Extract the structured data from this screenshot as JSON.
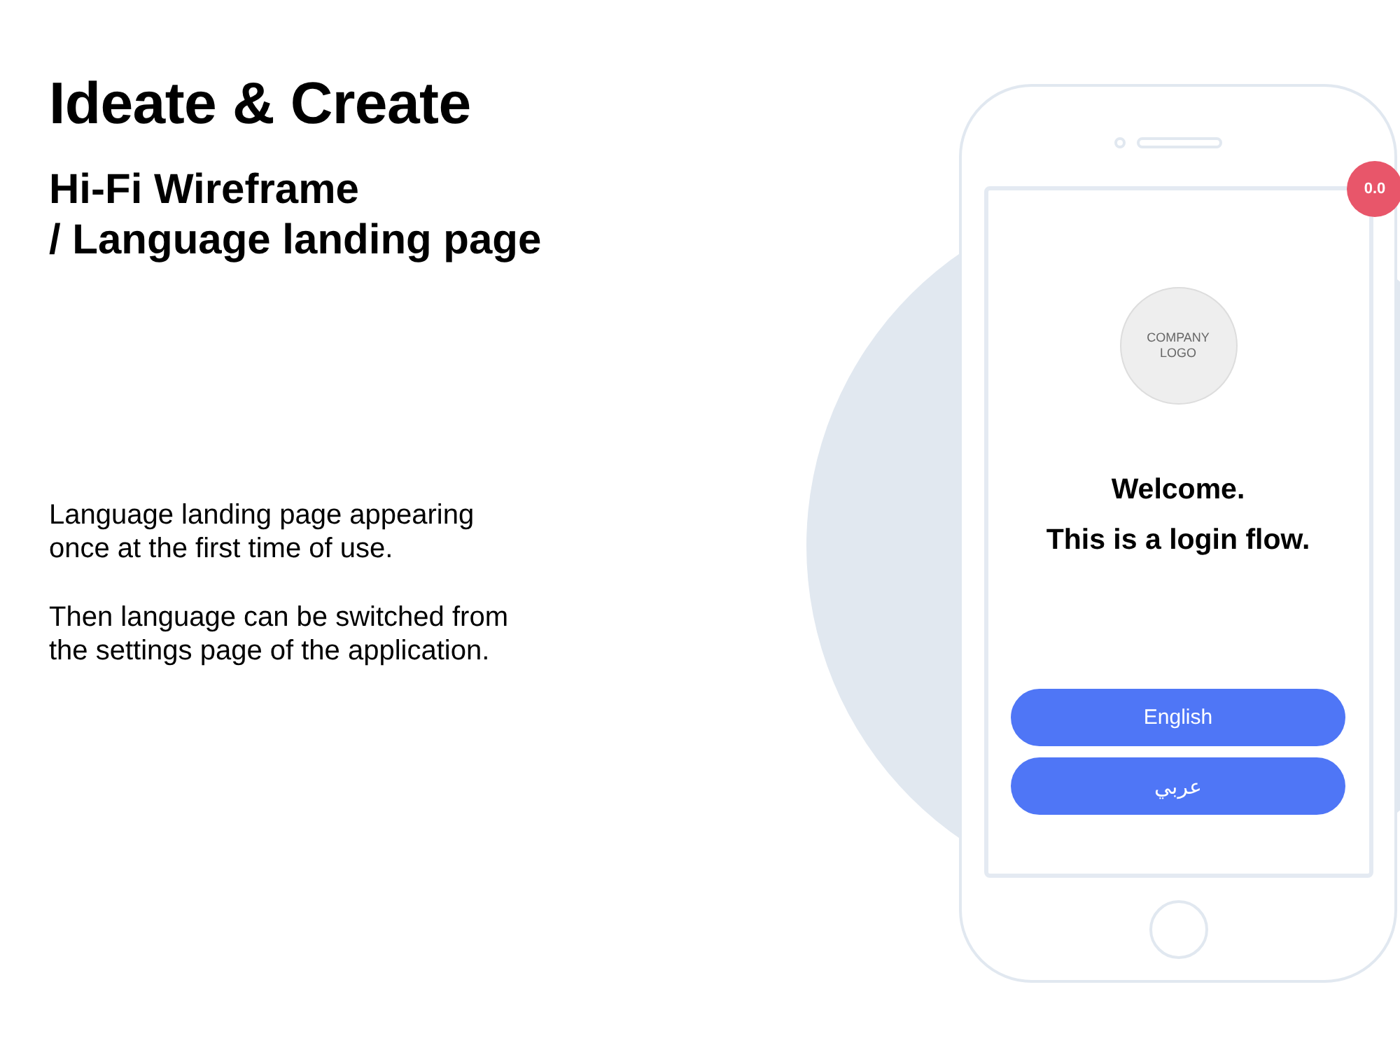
{
  "slide": {
    "title": "Ideate & Create",
    "subtitle": "Hi-Fi Wireframe\n/ Language landing page",
    "paragraphs": [
      "Language landing page appearing\nonce at the first time of use.",
      "Then language can be switched from\nthe settings page of the application."
    ]
  },
  "phone": {
    "badge": "0.0",
    "logo": "COMPANY\nLOGO",
    "welcome_title": "Welcome.",
    "welcome_text": "This is a login flow.",
    "language_buttons": [
      {
        "label": "English"
      },
      {
        "label": "عربي"
      }
    ]
  }
}
